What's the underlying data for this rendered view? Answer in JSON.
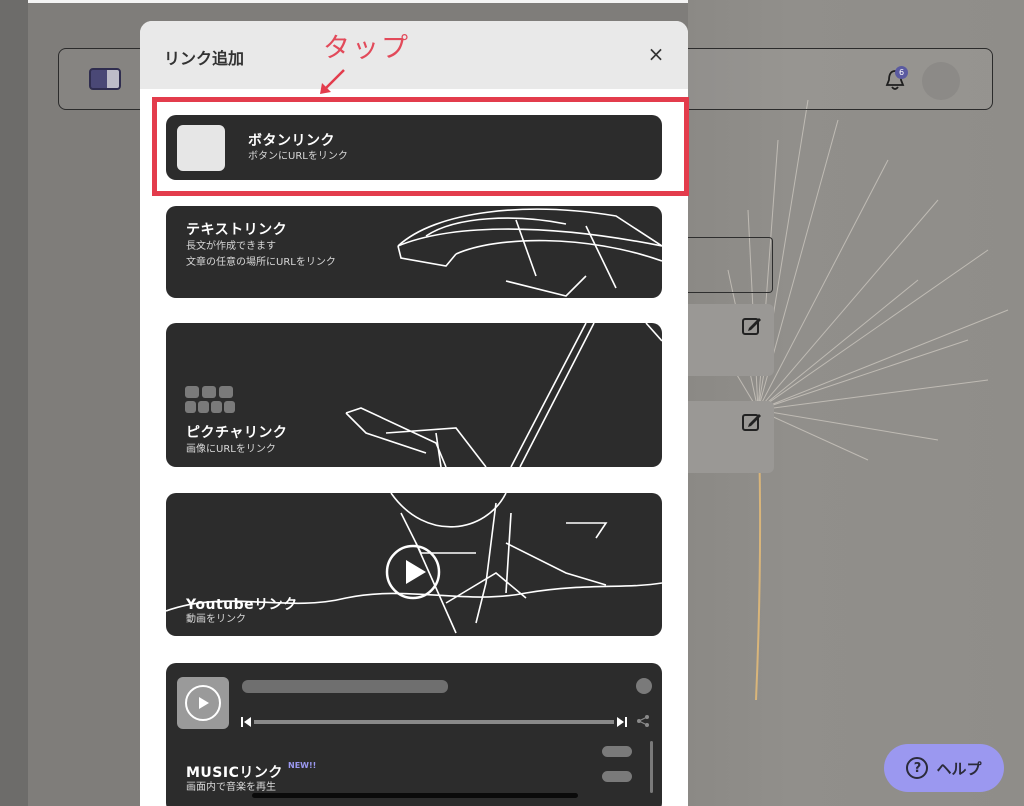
{
  "background": {
    "notification_count": "6"
  },
  "modal": {
    "title": "リンク追加",
    "close": "×",
    "cards": [
      {
        "title": "ボタンリンク",
        "subtitle": "ボタンにURLをリンク"
      },
      {
        "title": "テキストリンク",
        "subtitle": "長文が作成できます",
        "subtitle2": "文章の任意の場所にURLをリンク"
      },
      {
        "title": "ピクチャリンク",
        "subtitle": "画像にURLをリンク"
      },
      {
        "title": "Youtubeリンク",
        "subtitle": "動画をリンク"
      },
      {
        "title": "MUSICリンク",
        "badge": "NEW!!",
        "subtitle": "画面内で音楽を再生"
      }
    ]
  },
  "help": {
    "label": "ヘルプ",
    "icon_glyph": "?"
  },
  "annotation": {
    "label": "タップ",
    "color": "#e33c4c"
  },
  "colors": {
    "card_bg": "#2c2c2c",
    "accent": "#9b98f0",
    "annotation": "#e33c4c"
  }
}
